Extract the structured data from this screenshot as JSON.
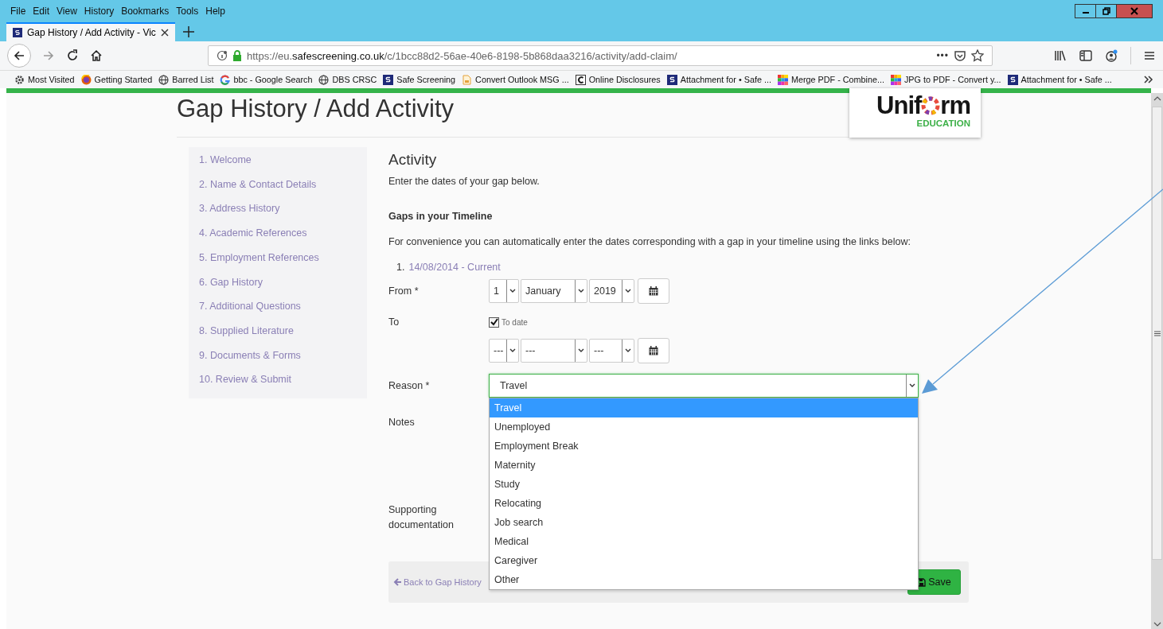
{
  "menu_bar": [
    "File",
    "Edit",
    "View",
    "History",
    "Bookmarks",
    "Tools",
    "Help"
  ],
  "tabs": [
    {
      "label": "Gap History / Add Activity - Vic",
      "selected": true
    }
  ],
  "address_bar": {
    "url_prefix": "https://eu.",
    "url_domain": "safescreening.co.uk",
    "url_path": "/c/1bcc88d2-56ae-40e6-8198-5b868daa3216/activity/add-claim/",
    "more": "•••"
  },
  "bookmarks": [
    {
      "label": "Most Visited",
      "kind": "gear"
    },
    {
      "label": "Getting Started",
      "kind": "firefox"
    },
    {
      "label": "Barred List",
      "kind": "globe"
    },
    {
      "label": "bbc - Google Search",
      "kind": "google"
    },
    {
      "label": "DBS CRSC",
      "kind": "globe"
    },
    {
      "label": "Safe Screening",
      "kind": "s"
    },
    {
      "label": "Convert Outlook MSG ...",
      "kind": "doc"
    },
    {
      "label": "Online Disclosures",
      "kind": "c"
    },
    {
      "label": "Attachment for • Safe ...",
      "kind": "s"
    },
    {
      "label": "Merge PDF - Combine...",
      "kind": "grid"
    },
    {
      "label": "JPG to PDF - Convert y...",
      "kind": "grid"
    },
    {
      "label": "Attachment for • Safe ...",
      "kind": "s"
    }
  ],
  "page": {
    "title": "Gap History / Add Activity",
    "logo": {
      "before": "Unif",
      "after": "rm",
      "subtitle": "EDUCATION"
    },
    "steps": [
      "1. Welcome",
      "2. Name & Contact Details",
      "3. Address History",
      "4. Academic References",
      "5. Employment References",
      "6. Gap History",
      "7. Additional Questions",
      "8. Supplied Literature",
      "9. Documents & Forms",
      "10. Review & Submit"
    ],
    "heading": "Activity",
    "intro": "Enter the dates of your gap below.",
    "gaps_heading": "Gaps in your Timeline",
    "gaps_text": "For convenience you can automatically enter the dates corresponding with a gap in your timeline using the links below:",
    "gap_links": [
      {
        "number": "1.",
        "label": "14/08/2014 - Current"
      }
    ],
    "from": {
      "label": "From *",
      "day": "1",
      "month": "January",
      "year": "2019"
    },
    "to": {
      "label": "To",
      "to_date": {
        "label": "To date",
        "checked": true
      },
      "day": "---",
      "month": "---",
      "year": "---"
    },
    "reason": {
      "label": "Reason *",
      "value": "Travel",
      "options": [
        {
          "label": "Travel",
          "selected": true
        },
        {
          "label": "Unemployed",
          "selected": false
        },
        {
          "label": "Employment Break",
          "selected": false
        },
        {
          "label": "Maternity",
          "selected": false
        },
        {
          "label": "Study",
          "selected": false
        },
        {
          "label": "Relocating",
          "selected": false
        },
        {
          "label": "Job search",
          "selected": false
        },
        {
          "label": "Medical",
          "selected": false
        },
        {
          "label": "Caregiver",
          "selected": false
        },
        {
          "label": "Other",
          "selected": false
        }
      ]
    },
    "notes_label": "Notes",
    "supporting_label": "Supporting documentation",
    "back": "Back to Gap History",
    "save": "Save"
  }
}
